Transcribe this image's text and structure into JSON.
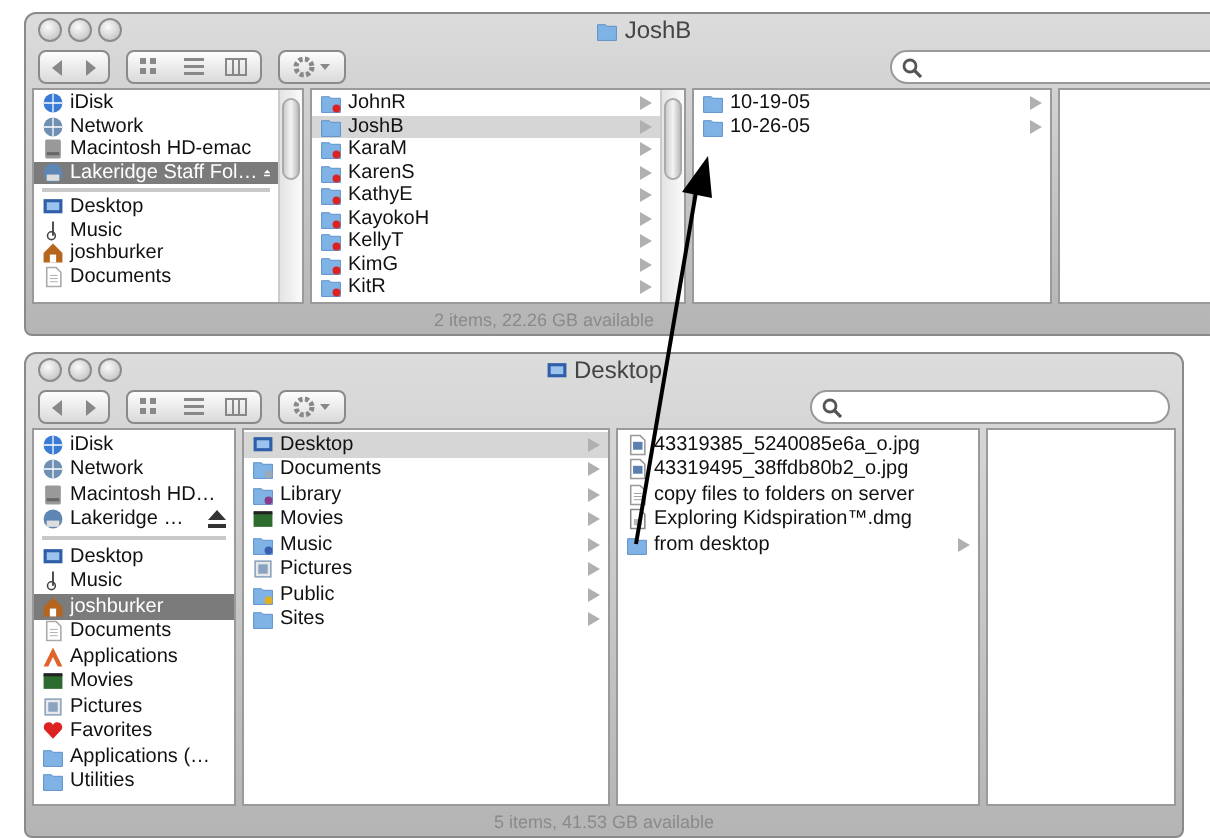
{
  "windows": [
    {
      "title": "JoshB",
      "sidebar": {
        "scrollbar": true,
        "groups": [
          {
            "items": [
              {
                "label": "iDisk",
                "kind": "idisk",
                "selected": false,
                "eject": false
              },
              {
                "label": "Network",
                "kind": "network",
                "selected": false,
                "eject": false
              },
              {
                "label": "Macintosh HD-emac",
                "kind": "disk",
                "selected": false,
                "eject": false
              },
              {
                "label": "Lakeridge Staff Fol…",
                "kind": "server",
                "selected": true,
                "eject": true
              }
            ]
          },
          {
            "items": [
              {
                "label": "Desktop",
                "kind": "desktop",
                "selected": false,
                "eject": false
              },
              {
                "label": "Music",
                "kind": "music",
                "selected": false,
                "eject": false
              },
              {
                "label": "joshburker",
                "kind": "home",
                "selected": false,
                "eject": false
              },
              {
                "label": "Documents",
                "kind": "documents",
                "selected": false,
                "eject": false
              }
            ]
          }
        ]
      },
      "columns": [
        {
          "scrollbar": true,
          "items": [
            {
              "label": "JohnR",
              "kind": "locked-folder",
              "selected": false,
              "arrow": true
            },
            {
              "label": "JoshB",
              "kind": "folder",
              "selected": true,
              "arrow": true
            },
            {
              "label": "KaraM",
              "kind": "locked-folder",
              "selected": false,
              "arrow": true
            },
            {
              "label": "KarenS",
              "kind": "locked-folder",
              "selected": false,
              "arrow": true
            },
            {
              "label": "KathyE",
              "kind": "locked-folder",
              "selected": false,
              "arrow": true
            },
            {
              "label": "KayokoH",
              "kind": "locked-folder",
              "selected": false,
              "arrow": true
            },
            {
              "label": "KellyT",
              "kind": "locked-folder",
              "selected": false,
              "arrow": true
            },
            {
              "label": "KimG",
              "kind": "locked-folder",
              "selected": false,
              "arrow": true
            },
            {
              "label": "KitR",
              "kind": "locked-folder",
              "selected": false,
              "arrow": true
            }
          ]
        },
        {
          "scrollbar": false,
          "items": [
            {
              "label": "10-19-05",
              "kind": "folder",
              "selected": false,
              "arrow": true
            },
            {
              "label": "10-26-05",
              "kind": "folder",
              "selected": false,
              "arrow": true
            }
          ]
        }
      ],
      "status": "2 items, 22.26 GB available"
    },
    {
      "title": "Desktop",
      "sidebar": {
        "scrollbar": false,
        "groups": [
          {
            "items": [
              {
                "label": "iDisk",
                "kind": "idisk",
                "selected": false,
                "eject": false
              },
              {
                "label": "Network",
                "kind": "network",
                "selected": false,
                "eject": false
              },
              {
                "label": "Macintosh HD…",
                "kind": "disk",
                "selected": false,
                "eject": false
              },
              {
                "label": "Lakeridge …",
                "kind": "server",
                "selected": false,
                "eject": true
              }
            ]
          },
          {
            "items": [
              {
                "label": "Desktop",
                "kind": "desktop",
                "selected": false,
                "eject": false
              },
              {
                "label": "Music",
                "kind": "music",
                "selected": false,
                "eject": false
              },
              {
                "label": "joshburker",
                "kind": "home",
                "selected": true,
                "eject": false
              },
              {
                "label": "Documents",
                "kind": "documents",
                "selected": false,
                "eject": false
              },
              {
                "label": "Applications",
                "kind": "applications",
                "selected": false,
                "eject": false
              },
              {
                "label": "Movies",
                "kind": "movies",
                "selected": false,
                "eject": false
              },
              {
                "label": "Pictures",
                "kind": "pictures",
                "selected": false,
                "eject": false
              },
              {
                "label": "Favorites",
                "kind": "favorites",
                "selected": false,
                "eject": false
              },
              {
                "label": "Applications (…",
                "kind": "folder",
                "selected": false,
                "eject": false
              },
              {
                "label": "Utilities",
                "kind": "folder",
                "selected": false,
                "eject": false
              }
            ]
          }
        ]
      },
      "columns": [
        {
          "scrollbar": false,
          "items": [
            {
              "label": "Desktop",
              "kind": "desktop",
              "selected": true,
              "arrow": true
            },
            {
              "label": "Documents",
              "kind": "documents-folder",
              "selected": false,
              "arrow": true
            },
            {
              "label": "Library",
              "kind": "library",
              "selected": false,
              "arrow": true
            },
            {
              "label": "Movies",
              "kind": "movies",
              "selected": false,
              "arrow": true
            },
            {
              "label": "Music",
              "kind": "music-folder",
              "selected": false,
              "arrow": true
            },
            {
              "label": "Pictures",
              "kind": "pictures",
              "selected": false,
              "arrow": true
            },
            {
              "label": "Public",
              "kind": "public",
              "selected": false,
              "arrow": true
            },
            {
              "label": "Sites",
              "kind": "folder",
              "selected": false,
              "arrow": true
            }
          ]
        },
        {
          "scrollbar": false,
          "items": [
            {
              "label": "43319385_5240085e6a_o.jpg",
              "kind": "image",
              "selected": false,
              "arrow": false
            },
            {
              "label": "43319495_38ffdb80b2_o.jpg",
              "kind": "image",
              "selected": false,
              "arrow": false
            },
            {
              "label": "copy files to folders on server",
              "kind": "text",
              "selected": false,
              "arrow": false
            },
            {
              "label": "Exploring Kidspiration™.dmg",
              "kind": "dmg",
              "selected": false,
              "arrow": false
            },
            {
              "label": "from desktop",
              "kind": "folder",
              "selected": false,
              "arrow": true
            }
          ]
        }
      ],
      "status": "5 items, 41.53 GB available"
    }
  ],
  "annotation": {
    "kind": "arrow"
  }
}
